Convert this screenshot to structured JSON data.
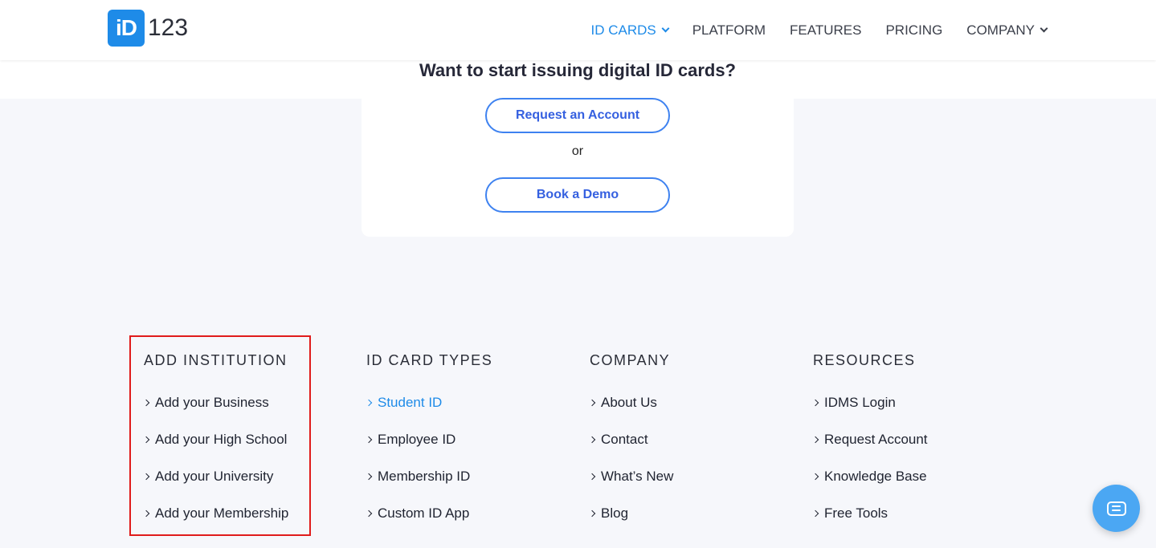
{
  "brand": {
    "logo_mark": "iD",
    "logo_text": "123",
    "accent_color": "#1e8be8"
  },
  "nav": {
    "items": [
      {
        "label": "ID CARDS",
        "dropdown": true,
        "active": true
      },
      {
        "label": "PLATFORM"
      },
      {
        "label": "FEATURES"
      },
      {
        "label": "PRICING"
      },
      {
        "label": "COMPANY",
        "dropdown": true
      }
    ]
  },
  "cta": {
    "title": "Want to start issuing digital ID cards?",
    "primary_label": "Request an Account",
    "or_text": "or",
    "secondary_label": "Book a Demo"
  },
  "footer": {
    "columns": [
      {
        "title": "ADD INSTITUTION",
        "links": [
          "Add your Business",
          "Add your High School",
          "Add your University",
          "Add your Membership"
        ]
      },
      {
        "title": "ID CARD TYPES",
        "links": [
          "Student ID",
          "Employee ID",
          "Membership ID",
          "Custom ID App"
        ],
        "active_link": 0
      },
      {
        "title": "COMPANY",
        "links": [
          "About Us",
          "Contact",
          "What’s New",
          "Blog"
        ]
      },
      {
        "title": "RESOURCES",
        "links": [
          "IDMS Login",
          "Request Account",
          "Knowledge Base",
          "Free Tools"
        ]
      }
    ]
  },
  "chat": {
    "icon": "chat-icon"
  }
}
